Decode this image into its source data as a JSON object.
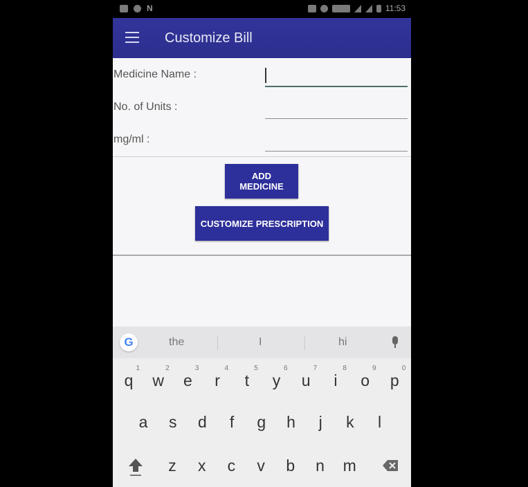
{
  "status_bar": {
    "time": "11:53",
    "network_label": "N"
  },
  "app_bar": {
    "title": "Customize Bill"
  },
  "form": {
    "medicine_name": {
      "label": "Medicine Name :",
      "value": ""
    },
    "units": {
      "label": "No. of Units :",
      "value": ""
    },
    "dose": {
      "label": "mg/ml :",
      "value": ""
    }
  },
  "buttons": {
    "add_medicine": "ADD MEDICINE",
    "customize_prescription": "CUSTOMIZE PRESCRIPTION"
  },
  "keyboard": {
    "suggestions": [
      "the",
      "I",
      "hi"
    ],
    "row1": [
      {
        "key": "q",
        "hint": "1"
      },
      {
        "key": "w",
        "hint": "2"
      },
      {
        "key": "e",
        "hint": "3"
      },
      {
        "key": "r",
        "hint": "4"
      },
      {
        "key": "t",
        "hint": "5"
      },
      {
        "key": "y",
        "hint": "6"
      },
      {
        "key": "u",
        "hint": "7"
      },
      {
        "key": "i",
        "hint": "8"
      },
      {
        "key": "o",
        "hint": "9"
      },
      {
        "key": "p",
        "hint": "0"
      }
    ],
    "row2": [
      "a",
      "s",
      "d",
      "f",
      "g",
      "h",
      "j",
      "k",
      "l"
    ],
    "row3": [
      "z",
      "x",
      "c",
      "v",
      "b",
      "n",
      "m"
    ]
  },
  "colors": {
    "primary": "#2d2f9a",
    "app_bar": "#32349a"
  }
}
